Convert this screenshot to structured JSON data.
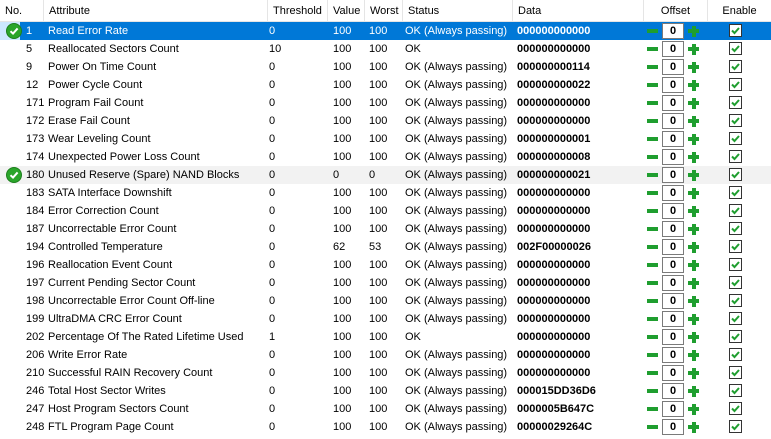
{
  "columns": {
    "no": "No.",
    "attribute": "Attribute",
    "threshold": "Threshold",
    "value": "Value",
    "worst": "Worst",
    "status": "Status",
    "data": "Data",
    "offset": "Offset",
    "enable": "Enable"
  },
  "colors": {
    "selected": "#0078d7",
    "ok_icon": "#2aa52a",
    "stepper": "#1f9e2f"
  },
  "rows": [
    {
      "no": "1",
      "attribute": "Read Error Rate",
      "threshold": "0",
      "value": "100",
      "worst": "100",
      "status": "OK (Always passing)",
      "data": "000000000000",
      "offset": "0",
      "enabled": true,
      "selected": true,
      "ok_icon": true
    },
    {
      "no": "5",
      "attribute": "Reallocated Sectors Count",
      "threshold": "10",
      "value": "100",
      "worst": "100",
      "status": "OK",
      "data": "000000000000",
      "offset": "0",
      "enabled": true
    },
    {
      "no": "9",
      "attribute": "Power On Time Count",
      "threshold": "0",
      "value": "100",
      "worst": "100",
      "status": "OK (Always passing)",
      "data": "000000000114",
      "offset": "0",
      "enabled": true
    },
    {
      "no": "12",
      "attribute": "Power Cycle Count",
      "threshold": "0",
      "value": "100",
      "worst": "100",
      "status": "OK (Always passing)",
      "data": "000000000022",
      "offset": "0",
      "enabled": true
    },
    {
      "no": "171",
      "attribute": "Program Fail Count",
      "threshold": "0",
      "value": "100",
      "worst": "100",
      "status": "OK (Always passing)",
      "data": "000000000000",
      "offset": "0",
      "enabled": true
    },
    {
      "no": "172",
      "attribute": "Erase Fail Count",
      "threshold": "0",
      "value": "100",
      "worst": "100",
      "status": "OK (Always passing)",
      "data": "000000000000",
      "offset": "0",
      "enabled": true
    },
    {
      "no": "173",
      "attribute": "Wear Leveling Count",
      "threshold": "0",
      "value": "100",
      "worst": "100",
      "status": "OK (Always passing)",
      "data": "000000000001",
      "offset": "0",
      "enabled": true
    },
    {
      "no": "174",
      "attribute": "Unexpected Power Loss Count",
      "threshold": "0",
      "value": "100",
      "worst": "100",
      "status": "OK (Always passing)",
      "data": "000000000008",
      "offset": "0",
      "enabled": true
    },
    {
      "no": "180",
      "attribute": "Unused Reserve (Spare) NAND Blocks",
      "threshold": "0",
      "value": "0",
      "worst": "0",
      "status": "OK (Always passing)",
      "data": "000000000021",
      "offset": "0",
      "enabled": true,
      "alt": true,
      "ok_icon": true
    },
    {
      "no": "183",
      "attribute": "SATA Interface Downshift",
      "threshold": "0",
      "value": "100",
      "worst": "100",
      "status": "OK (Always passing)",
      "data": "000000000000",
      "offset": "0",
      "enabled": true
    },
    {
      "no": "184",
      "attribute": "Error Correction Count",
      "threshold": "0",
      "value": "100",
      "worst": "100",
      "status": "OK (Always passing)",
      "data": "000000000000",
      "offset": "0",
      "enabled": true
    },
    {
      "no": "187",
      "attribute": "Uncorrectable Error Count",
      "threshold": "0",
      "value": "100",
      "worst": "100",
      "status": "OK (Always passing)",
      "data": "000000000000",
      "offset": "0",
      "enabled": true
    },
    {
      "no": "194",
      "attribute": "Controlled Temperature",
      "threshold": "0",
      "value": "62",
      "worst": "53",
      "status": "OK (Always passing)",
      "data": "002F00000026",
      "offset": "0",
      "enabled": true
    },
    {
      "no": "196",
      "attribute": "Reallocation Event Count",
      "threshold": "0",
      "value": "100",
      "worst": "100",
      "status": "OK (Always passing)",
      "data": "000000000000",
      "offset": "0",
      "enabled": true
    },
    {
      "no": "197",
      "attribute": "Current Pending Sector Count",
      "threshold": "0",
      "value": "100",
      "worst": "100",
      "status": "OK (Always passing)",
      "data": "000000000000",
      "offset": "0",
      "enabled": true
    },
    {
      "no": "198",
      "attribute": "Uncorrectable Error Count Off-line",
      "threshold": "0",
      "value": "100",
      "worst": "100",
      "status": "OK (Always passing)",
      "data": "000000000000",
      "offset": "0",
      "enabled": true
    },
    {
      "no": "199",
      "attribute": "UltraDMA CRC Error Count",
      "threshold": "0",
      "value": "100",
      "worst": "100",
      "status": "OK (Always passing)",
      "data": "000000000000",
      "offset": "0",
      "enabled": true
    },
    {
      "no": "202",
      "attribute": "Percentage Of The Rated Lifetime Used",
      "threshold": "1",
      "value": "100",
      "worst": "100",
      "status": "OK",
      "data": "000000000000",
      "offset": "0",
      "enabled": true
    },
    {
      "no": "206",
      "attribute": "Write Error Rate",
      "threshold": "0",
      "value": "100",
      "worst": "100",
      "status": "OK (Always passing)",
      "data": "000000000000",
      "offset": "0",
      "enabled": true
    },
    {
      "no": "210",
      "attribute": "Successful RAIN Recovery Count",
      "threshold": "0",
      "value": "100",
      "worst": "100",
      "status": "OK (Always passing)",
      "data": "000000000000",
      "offset": "0",
      "enabled": true
    },
    {
      "no": "246",
      "attribute": "Total Host Sector Writes",
      "threshold": "0",
      "value": "100",
      "worst": "100",
      "status": "OK (Always passing)",
      "data": "000015DD36D6",
      "offset": "0",
      "enabled": true
    },
    {
      "no": "247",
      "attribute": "Host Program Sectors Count",
      "threshold": "0",
      "value": "100",
      "worst": "100",
      "status": "OK (Always passing)",
      "data": "0000005B647C",
      "offset": "0",
      "enabled": true
    },
    {
      "no": "248",
      "attribute": "FTL Program Page Count",
      "threshold": "0",
      "value": "100",
      "worst": "100",
      "status": "OK (Always passing)",
      "data": "00000029264C",
      "offset": "0",
      "enabled": true
    }
  ]
}
